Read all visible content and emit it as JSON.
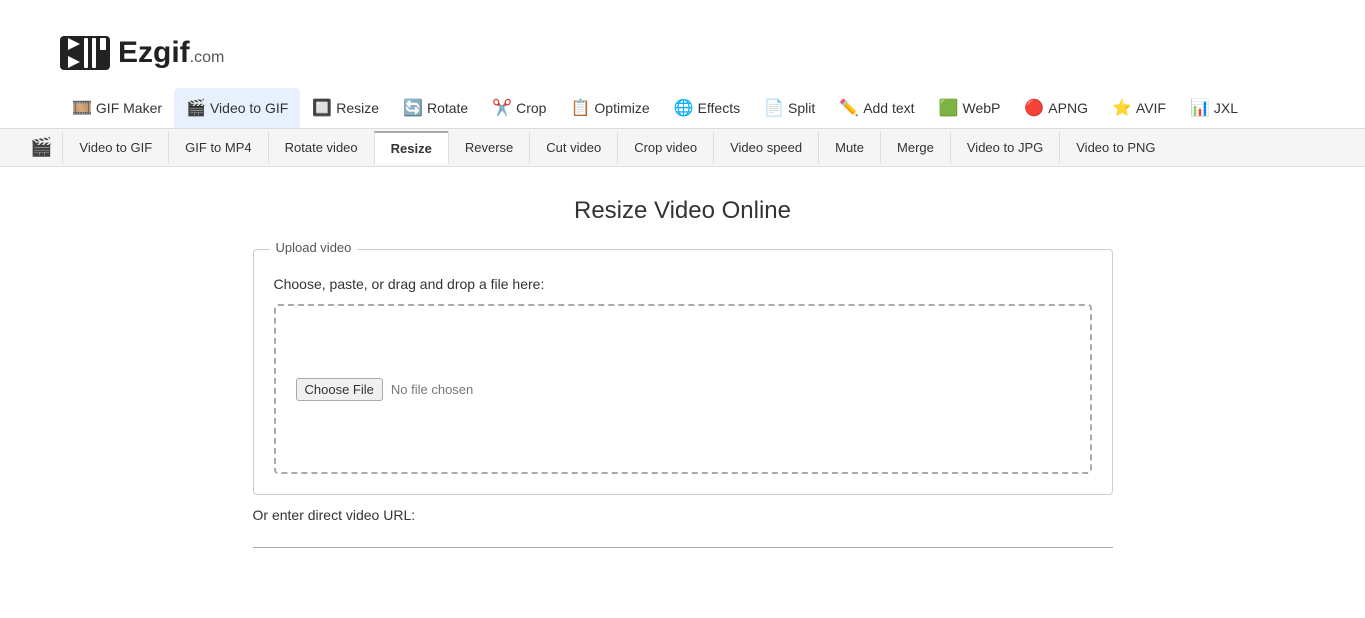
{
  "logo": {
    "text": "Ezgif",
    "suffix": ".com"
  },
  "main_nav": [
    {
      "id": "gif-maker",
      "icon": "🎞️",
      "label": "GIF Maker",
      "active": false
    },
    {
      "id": "video-to-gif",
      "icon": "🎬",
      "label": "Video to GIF",
      "active": true
    },
    {
      "id": "resize",
      "icon": "🔲",
      "label": "Resize",
      "active": false
    },
    {
      "id": "rotate",
      "icon": "🔄",
      "label": "Rotate",
      "active": false
    },
    {
      "id": "crop",
      "icon": "✂️",
      "label": "Crop",
      "active": false
    },
    {
      "id": "optimize",
      "icon": "📋",
      "label": "Optimize",
      "active": false
    },
    {
      "id": "effects",
      "icon": "🌐",
      "label": "Effects",
      "active": false
    },
    {
      "id": "split",
      "icon": "📄",
      "label": "Split",
      "active": false
    },
    {
      "id": "add-text",
      "icon": "✏️",
      "label": "Add text",
      "active": false
    },
    {
      "id": "webp",
      "icon": "🟩",
      "label": "WebP",
      "active": false
    },
    {
      "id": "apng",
      "icon": "🔴",
      "label": "APNG",
      "active": false
    },
    {
      "id": "avif",
      "icon": "⭐",
      "label": "AVIF",
      "active": false
    },
    {
      "id": "jxl",
      "icon": "📊",
      "label": "JXL",
      "active": false
    }
  ],
  "sub_nav": [
    {
      "id": "video-to-gif",
      "label": "Video to GIF",
      "active": false
    },
    {
      "id": "gif-to-mp4",
      "label": "GIF to MP4",
      "active": false
    },
    {
      "id": "rotate-video",
      "label": "Rotate video",
      "active": false
    },
    {
      "id": "resize",
      "label": "Resize",
      "active": true
    },
    {
      "id": "reverse",
      "label": "Reverse",
      "active": false
    },
    {
      "id": "cut-video",
      "label": "Cut video",
      "active": false
    },
    {
      "id": "crop-video",
      "label": "Crop video",
      "active": false
    },
    {
      "id": "video-speed",
      "label": "Video speed",
      "active": false
    },
    {
      "id": "mute",
      "label": "Mute",
      "active": false
    },
    {
      "id": "merge",
      "label": "Merge",
      "active": false
    },
    {
      "id": "video-to-jpg",
      "label": "Video to JPG",
      "active": false
    },
    {
      "id": "video-to-png",
      "label": "Video to PNG",
      "active": false
    }
  ],
  "page": {
    "title": "Resize Video Online"
  },
  "upload_section": {
    "legend": "Upload video",
    "description": "Choose, paste, or drag and drop a file here:",
    "choose_file_label": "Choose File",
    "no_file_text": "No file chosen",
    "url_label": "Or enter direct video URL:"
  }
}
